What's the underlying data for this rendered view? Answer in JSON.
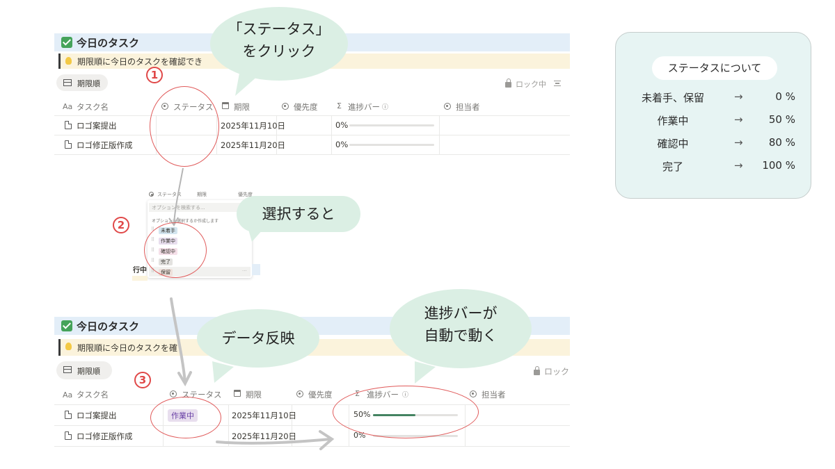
{
  "panel_top": {
    "title": "今日のタスク",
    "callout": "期限順に今日のタスクを確認でき",
    "view_tab": "期限順",
    "lock": "ロック中",
    "columns": [
      "タスク名",
      "ステータス",
      "期限",
      "優先度",
      "進捗バー",
      "担当者"
    ],
    "rows": [
      {
        "name": "ロゴ案提出",
        "status": "",
        "due": "2025年11月10日",
        "progress_label": "0%",
        "progress": 0
      },
      {
        "name": "ロゴ修正版作成",
        "status": "",
        "due": "2025年11月20日",
        "progress_label": "0%",
        "progress": 0
      }
    ]
  },
  "dropdown": {
    "columns": [
      "ステータス",
      "期限",
      "優先度"
    ],
    "search_placeholder": "オプションを検索する...",
    "hint": "オプションを選択するか作成します",
    "options": [
      {
        "label": "未着手",
        "bg": "#d3e5ef"
      },
      {
        "label": "作業中",
        "bg": "#e8deee"
      },
      {
        "label": "確認中",
        "bg": "#f5e0e9"
      },
      {
        "label": "完了",
        "bg": "#e3e2e0"
      },
      {
        "label": "保留",
        "bg": "#eee0da"
      }
    ],
    "left_fragment": "行中"
  },
  "panel_bottom": {
    "title": "今日のタスク",
    "callout": "期限順に今日のタスクを確",
    "view_tab": "期限順",
    "lock": "ロック",
    "columns": [
      "タスク名",
      "ステータス",
      "期限",
      "優先度",
      "進捗バー",
      "担当者"
    ],
    "rows": [
      {
        "name": "ロゴ案提出",
        "status": "作業中",
        "due": "2025年11月10日",
        "progress_label": "50%",
        "progress": 0.5
      },
      {
        "name": "ロゴ修正版作成",
        "status": "",
        "due": "2025年11月20日",
        "progress_label": "0%",
        "progress": 0
      }
    ]
  },
  "steps": [
    "1",
    "2",
    "3"
  ],
  "bubbles": {
    "click_status_line1": "「ステータス」",
    "click_status_line2": "をクリック",
    "select": "選択すると",
    "data_reflect": "データ反映",
    "progress_line1": "進捗バーが",
    "progress_line2": "自動で動く"
  },
  "legend": {
    "title": "ステータスについて",
    "rows": [
      {
        "status": "未着手、保留",
        "arrow": "→",
        "pct": "0 %"
      },
      {
        "status": "作業中",
        "arrow": "→",
        "pct": "50 %"
      },
      {
        "status": "確認中",
        "arrow": "→",
        "pct": "80 %"
      },
      {
        "status": "完了",
        "arrow": "→",
        "pct": "100 %"
      }
    ]
  },
  "colors": {
    "bubble_green": "#dbefe4",
    "annotation_red": "#e05a5a",
    "progress_green": "#448361",
    "legend_bg": "#e7f4f3"
  }
}
